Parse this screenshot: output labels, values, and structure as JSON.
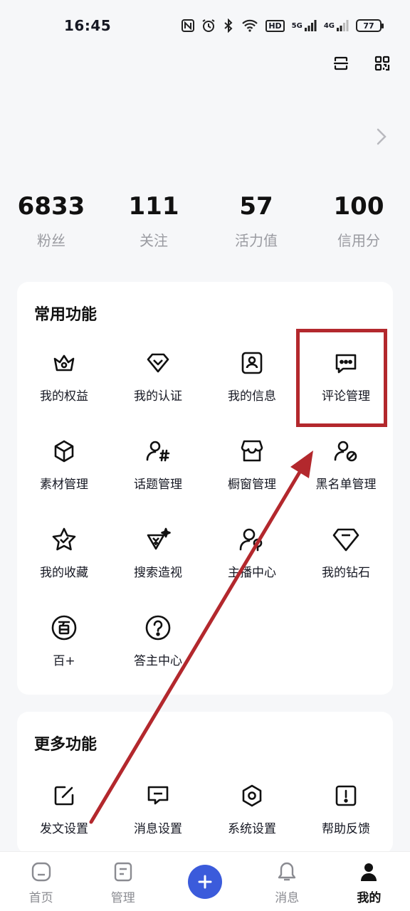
{
  "status_bar": {
    "time": "16:45",
    "icons": [
      "nfc-icon",
      "alarm-icon",
      "bluetooth-icon",
      "wifi-icon",
      "hd-icon",
      "signal-5g-icon",
      "signal-4g-icon"
    ],
    "hd": "HD",
    "net1": "5G",
    "net2": "4G",
    "battery": "77"
  },
  "header": {
    "actions": [
      "scan-icon",
      "qr-code-icon"
    ]
  },
  "stats": [
    {
      "value": "6833",
      "label": "粉丝"
    },
    {
      "value": "111",
      "label": "关注"
    },
    {
      "value": "57",
      "label": "活力值"
    },
    {
      "value": "100",
      "label": "信用分"
    }
  ],
  "common": {
    "title": "常用功能",
    "items": [
      {
        "label": "我的权益",
        "icon": "crown-icon"
      },
      {
        "label": "我的认证",
        "icon": "verified-badge-icon"
      },
      {
        "label": "我的信息",
        "icon": "profile-card-icon"
      },
      {
        "label": "评论管理",
        "icon": "comment-icon"
      },
      {
        "label": "素材管理",
        "icon": "cube-icon"
      },
      {
        "label": "话题管理",
        "icon": "user-hashtag-icon"
      },
      {
        "label": "橱窗管理",
        "icon": "storefront-icon"
      },
      {
        "label": "黑名单管理",
        "icon": "user-blocked-icon"
      },
      {
        "label": "我的收藏",
        "icon": "star-check-icon"
      },
      {
        "label": "搜索造视",
        "icon": "sparkle-yuan-icon"
      },
      {
        "label": "主播中心",
        "icon": "streamer-mic-icon"
      },
      {
        "label": "我的钻石",
        "icon": "diamond-icon"
      },
      {
        "label": "百+",
        "icon": "bai-plus-icon"
      },
      {
        "label": "答主中心",
        "icon": "question-circle-icon"
      }
    ]
  },
  "more": {
    "title": "更多功能",
    "items": [
      {
        "label": "发文设置",
        "icon": "edit-square-icon"
      },
      {
        "label": "消息设置",
        "icon": "message-box-icon"
      },
      {
        "label": "系统设置",
        "icon": "hex-settings-icon"
      },
      {
        "label": "帮助反馈",
        "icon": "alert-square-icon"
      }
    ]
  },
  "tabbar": {
    "items": [
      {
        "label": "首页",
        "icon": "home-icon"
      },
      {
        "label": "管理",
        "icon": "manage-icon"
      },
      {
        "label": "",
        "icon": "plus-icon"
      },
      {
        "label": "消息",
        "icon": "bell-icon"
      },
      {
        "label": "我的",
        "icon": "user-icon"
      }
    ],
    "active": "我的"
  },
  "annotation": {
    "highlight_target": "评论管理",
    "color": "#b3282d"
  },
  "colors": {
    "accent": "#3b5bdb",
    "background": "#f6f7f9",
    "annotation": "#b3282d"
  }
}
